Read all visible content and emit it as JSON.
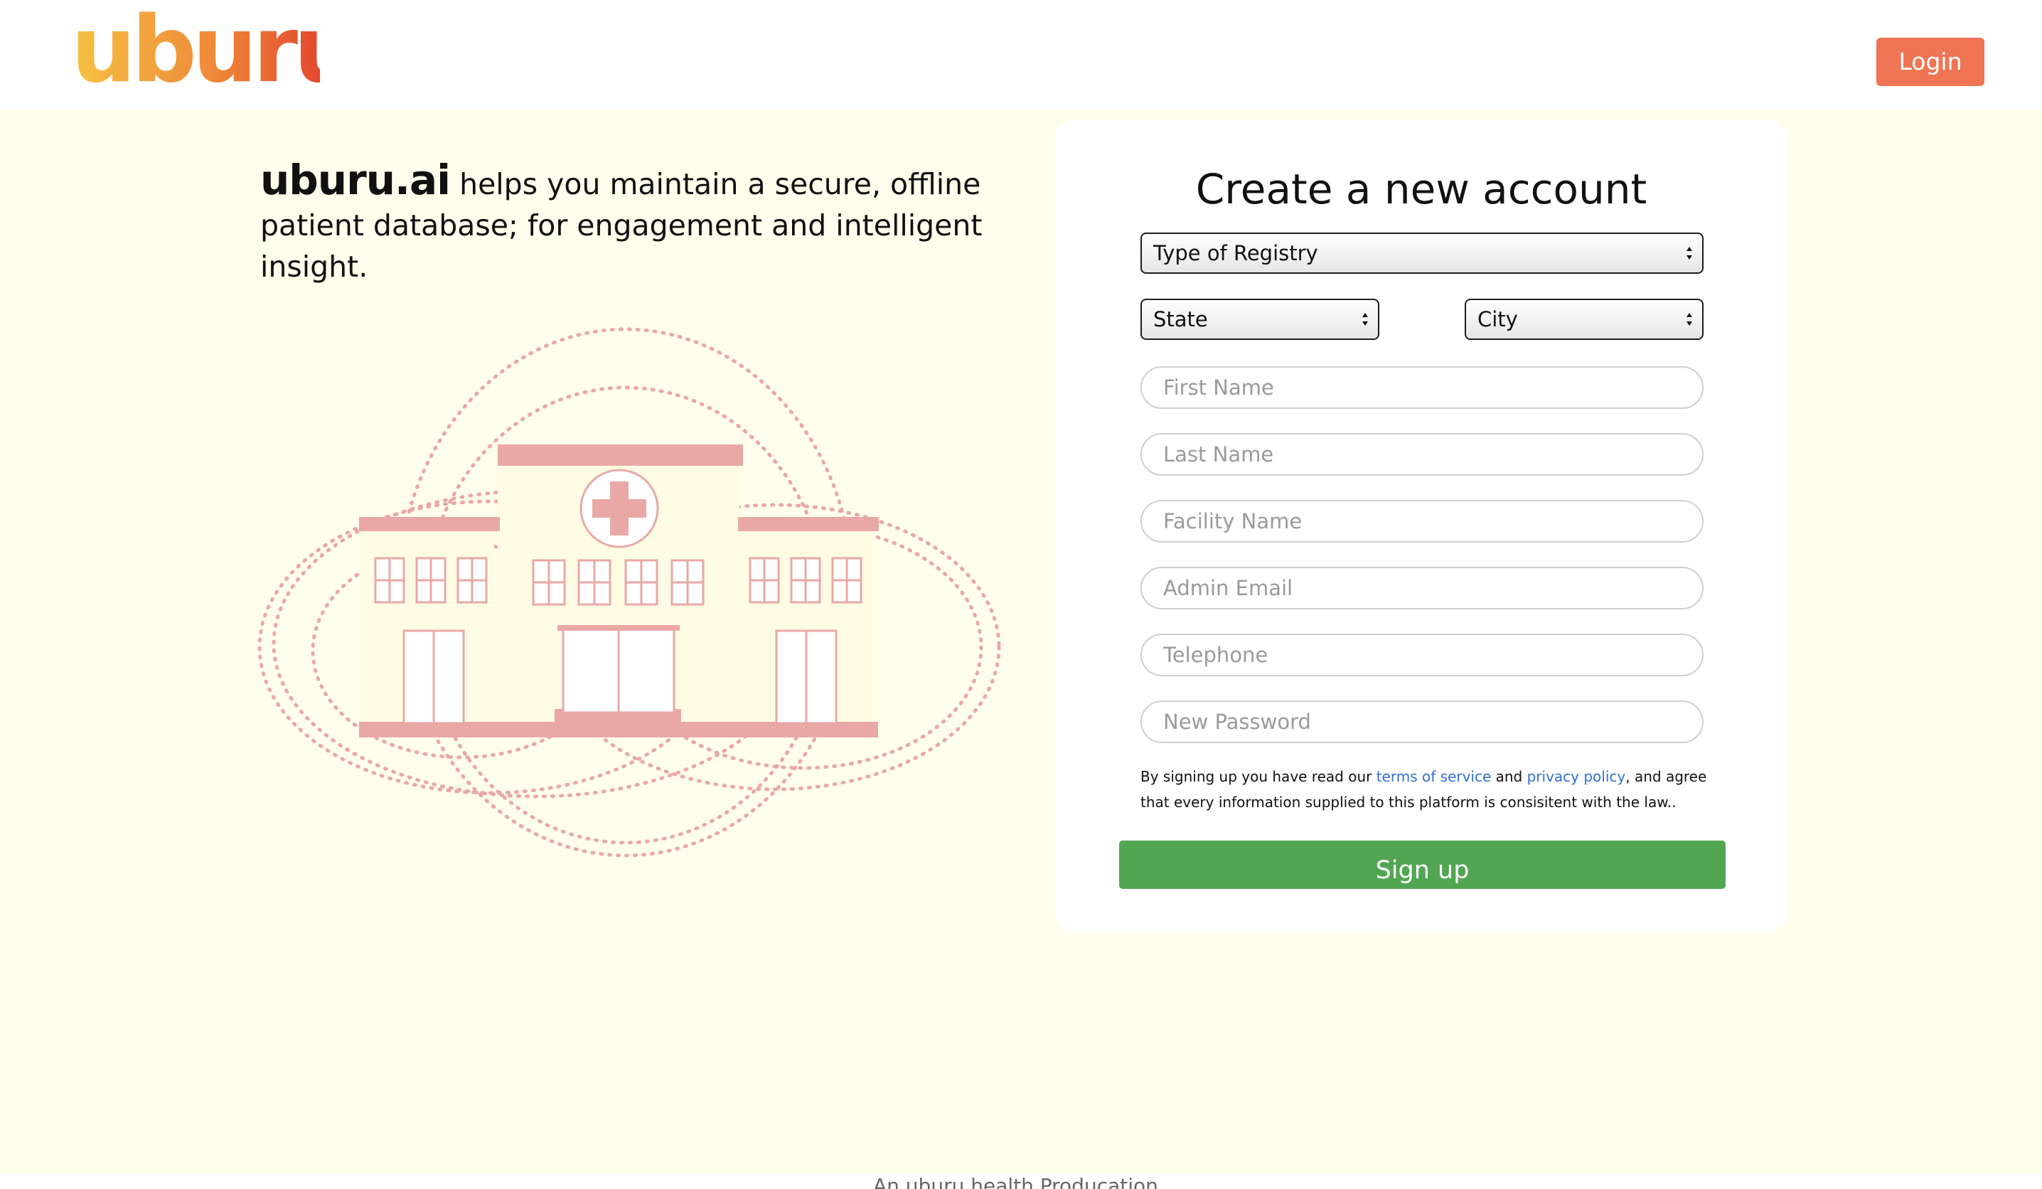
{
  "header": {
    "logo_text": "uburu",
    "login_label": "Login"
  },
  "hero": {
    "brand": "uburu.ai",
    "tagline": " helps you maintain a secure, offline patient database; for engagement and intelligent insight."
  },
  "form": {
    "title": "Create a new account",
    "registry_select": "Type of Registry",
    "state_select": "State",
    "city_select": "City",
    "first_name_placeholder": "First Name",
    "last_name_placeholder": "Last Name",
    "facility_name_placeholder": "Facility Name",
    "admin_email_placeholder": "Admin Email",
    "telephone_placeholder": "Telephone",
    "new_password_placeholder": "New Password",
    "terms_prefix": "By signing up you have read our ",
    "terms_link": "terms of service",
    "terms_and": " and ",
    "privacy_link": "privacy policy",
    "terms_suffix": ", and agree that every information supplied to this platform is consisitent with the law..",
    "signup_label": "Sign up"
  },
  "footer": {
    "text": "An uburu health Producation"
  },
  "colors": {
    "page_bg": "#fffdeb",
    "login_button": "#ef7554",
    "signup_button": "#52a653",
    "illustration": "#e9a8a6",
    "link": "#2f6fd6"
  }
}
